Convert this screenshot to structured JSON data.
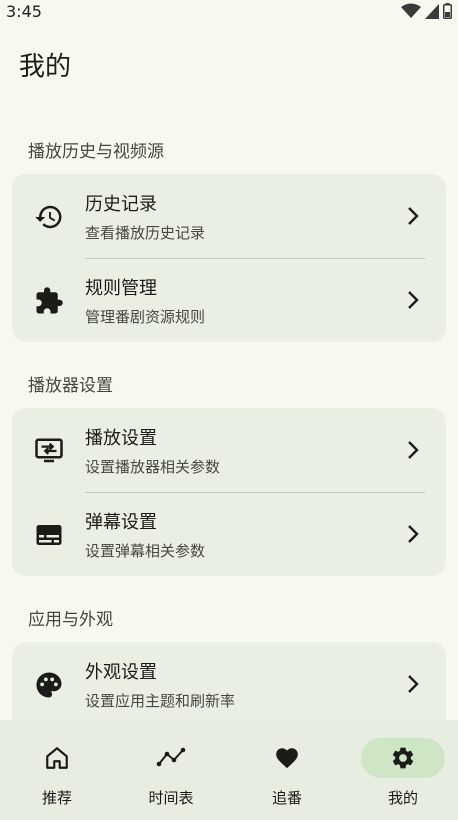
{
  "status_bar": {
    "time": "3:45"
  },
  "page": {
    "title": "我的"
  },
  "sections": [
    {
      "header": "播放历史与视频源",
      "items": [
        {
          "title": "历史记录",
          "subtitle": "查看播放历史记录",
          "icon": "history-icon"
        },
        {
          "title": "规则管理",
          "subtitle": "管理番剧资源规则",
          "icon": "puzzle-icon"
        }
      ]
    },
    {
      "header": "播放器设置",
      "items": [
        {
          "title": "播放设置",
          "subtitle": "设置播放器相关参数",
          "icon": "tv-swap-icon"
        },
        {
          "title": "弹幕设置",
          "subtitle": "设置弹幕相关参数",
          "icon": "subtitles-icon"
        }
      ]
    },
    {
      "header": "应用与外观",
      "items": [
        {
          "title": "外观设置",
          "subtitle": "设置应用主题和刷新率",
          "icon": "palette-icon"
        }
      ]
    }
  ],
  "bottom_nav": {
    "items": [
      {
        "label": "推荐",
        "icon": "home-icon"
      },
      {
        "label": "时间表",
        "icon": "timeline-icon"
      },
      {
        "label": "追番",
        "icon": "heart-icon"
      },
      {
        "label": "我的",
        "icon": "gear-icon",
        "active": true
      }
    ]
  },
  "colors": {
    "background": "#f6f9f0",
    "card": "#eaefe3",
    "nav_background": "#e8ede1",
    "nav_active_pill": "#cfe6c6",
    "text_primary": "#1b1c18",
    "text_secondary": "#45483f"
  }
}
